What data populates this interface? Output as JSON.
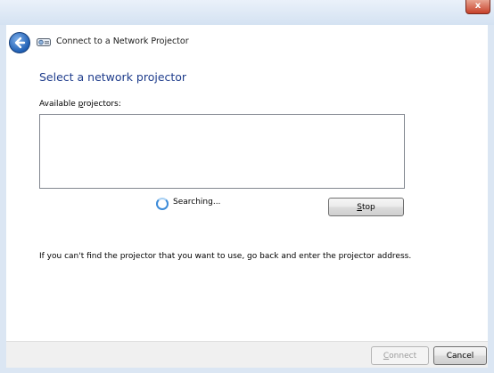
{
  "window": {
    "title": "Connect to a Network Projector",
    "close_label": "x"
  },
  "main": {
    "heading": "Select a network projector",
    "available_label_pre": "Available ",
    "available_label_u": "p",
    "available_label_post": "rojectors:",
    "searching_text": "Searching...",
    "stop_u": "S",
    "stop_rest": "top",
    "info_text": "If you can't find the projector that you want to use, go back and enter the projector address."
  },
  "footer": {
    "connect_u": "C",
    "connect_rest": "onnect",
    "cancel_label": "Cancel"
  }
}
